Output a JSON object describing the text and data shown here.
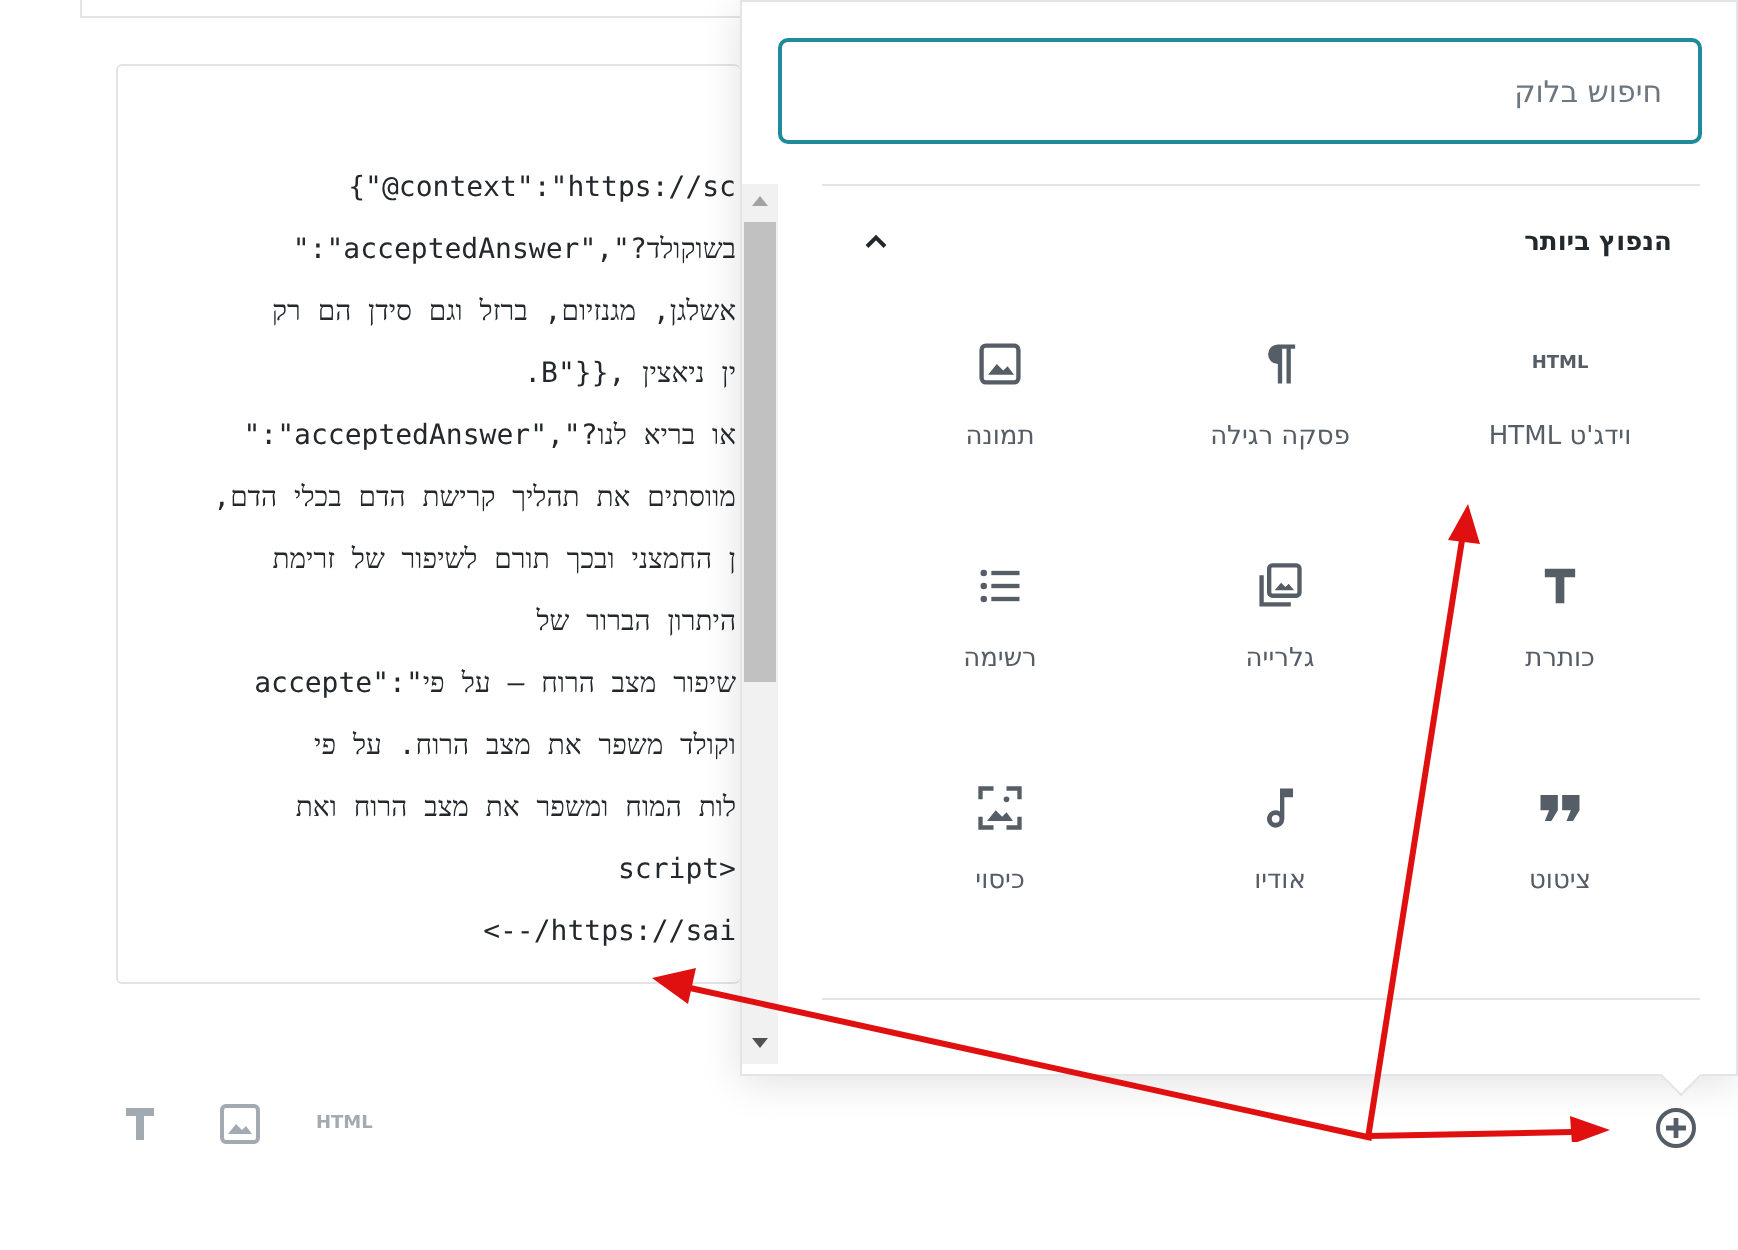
{
  "code_block": {
    "lines": [
      "{\"@context\":\"https://sc",
      "בשוקולד?\",\"acceptedAnswer\":\"",
      "אשלגן, מגנזיום, ברזל וגם סידן הם רק",
      "ין ניאצין ,{{\"B.",
      "או בריא לנו?\",\"acceptedAnswer\":\"",
      "מווסתים את תהליך קרישת הדם בכלי הדם,",
      "ן החמצני ובכך תורם לשיפור של זרימת",
      "היתרון הברור של",
      "accepte\":\"שיפור מצב הרוח – על פי",
      "וקולד משפר את מצב הרוח. על פי",
      "לות המוח ומשפר את מצב הרוח ואת",
      "script>",
      "<--/https://sai"
    ]
  },
  "inserter": {
    "search": {
      "placeholder": "חיפוש בלוק"
    },
    "section": {
      "title": "הנפוץ ביותר",
      "expanded": true
    },
    "blocks": [
      {
        "kind": "html",
        "icon_text": "HTML",
        "label": "וידג'ט HTML"
      },
      {
        "kind": "paragraph",
        "label": "פסקה רגילה"
      },
      {
        "kind": "image",
        "label": "תמונה"
      },
      {
        "kind": "heading",
        "label": "כותרת"
      },
      {
        "kind": "gallery",
        "label": "גלרייה"
      },
      {
        "kind": "list",
        "label": "רשימה"
      },
      {
        "kind": "quote",
        "label": "ציטוט"
      },
      {
        "kind": "audio",
        "label": "אודיו"
      },
      {
        "kind": "cover",
        "label": "כיסוי"
      }
    ]
  },
  "toolbar": [
    {
      "kind": "heading"
    },
    {
      "kind": "image"
    },
    {
      "kind": "html",
      "icon_text": "HTML"
    }
  ]
}
